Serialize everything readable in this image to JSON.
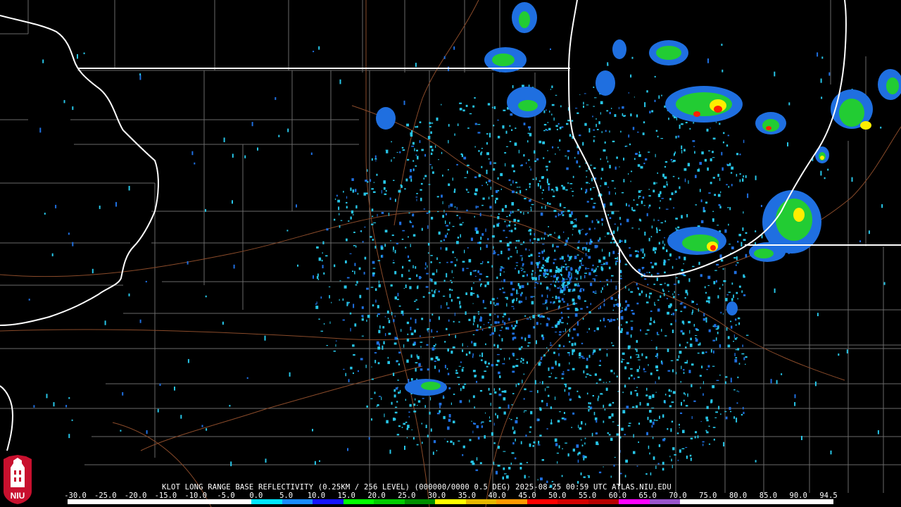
{
  "title": "KLOT LONG RANGE BASE REFLECTIVITY (0.25KM / 256 LEVEL) (000000/0000 0.5 DEG) 2025-08-25 00:59 UTC  ATLAS.NIU.EDU",
  "logo": {
    "text": "NIU",
    "name": "niu-logo"
  },
  "colorbar": {
    "labels": [
      "-30.0",
      "-25.0",
      "-20.0",
      "-15.0",
      "-10.0",
      "-5.0",
      "0.0",
      "5.0",
      "10.0",
      "15.0",
      "20.0",
      "25.0",
      "30.0",
      "35.0",
      "40.0",
      "45.0",
      "50.0",
      "55.0",
      "60.0",
      "65.0",
      "70.0",
      "75.0",
      "80.0",
      "85.0",
      "90.0",
      "94.5"
    ],
    "colors": [
      "#ffffff",
      "#ffffff",
      "#ffffff",
      "#ffffff",
      "#ffffff",
      "#ffffff",
      "#00e5ff",
      "#1a8cff",
      "#1414ff",
      "#00ff00",
      "#00cc00",
      "#008f00",
      "#ffff00",
      "#e6b800",
      "#ff9900",
      "#ff0000",
      "#d40000",
      "#b80000",
      "#ff00ff",
      "#9955cc",
      "#ffffff",
      "#ffffff",
      "#ffffff",
      "#ffffff",
      "#ffffff"
    ]
  },
  "map_colors": {
    "background": "#000000",
    "state_lines": "#ffffff",
    "county_lines": "#6a6a6a",
    "roads": "#8a4b2a",
    "echo_light": "#27c6e8",
    "echo_mid": "#1f6fe0",
    "echo_strong": "#22cc33",
    "echo_heavy": "#ffee00",
    "echo_intense": "#ff2200"
  }
}
